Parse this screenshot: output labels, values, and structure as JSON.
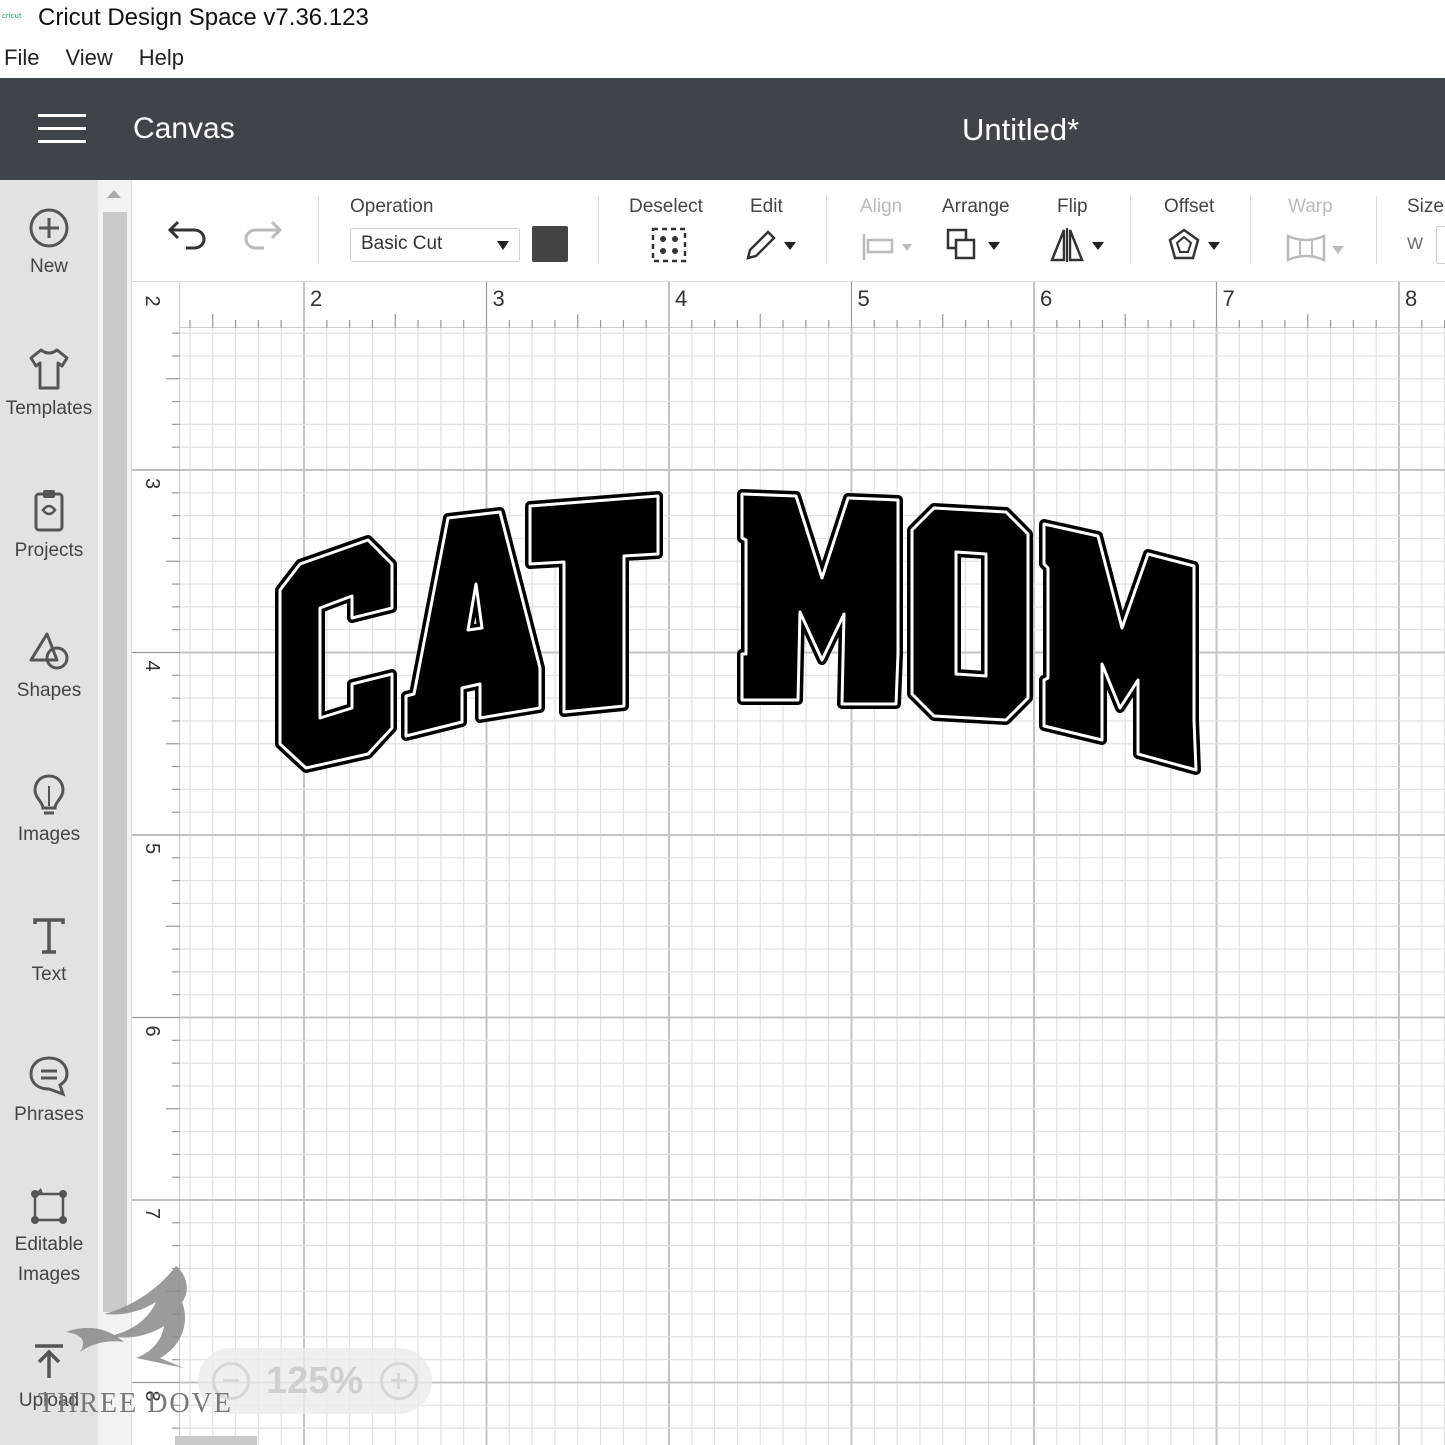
{
  "titlebar": {
    "logo_text": "cricut",
    "title": "Cricut Design Space  v7.36.123"
  },
  "menu": [
    "File",
    "View",
    "Help"
  ],
  "header": {
    "section": "Canvas",
    "document_title": "Untitled*"
  },
  "sidebar": {
    "items": [
      {
        "label": "New",
        "icon": "plus-circle-icon"
      },
      {
        "label": "Templates",
        "icon": "shirt-icon"
      },
      {
        "label": "Projects",
        "icon": "clipboard-icon"
      },
      {
        "label": "Shapes",
        "icon": "shapes-icon"
      },
      {
        "label": "Images",
        "icon": "lightbulb-icon"
      },
      {
        "label": "Text",
        "icon": "text-icon"
      },
      {
        "label": "Phrases",
        "icon": "speech-bubble-icon"
      },
      {
        "label": "Editable",
        "label2": "Images",
        "icon": "editable-images-icon"
      },
      {
        "label": "Upload",
        "icon": "upload-icon"
      }
    ]
  },
  "toolbar": {
    "operation_label": "Operation",
    "operation_value": "Basic Cut",
    "swatch_color": "#444444",
    "deselect": "Deselect",
    "edit": "Edit",
    "align": "Align",
    "arrange": "Arrange",
    "flip": "Flip",
    "offset": "Offset",
    "warp": "Warp",
    "size": "Size",
    "size_w": "W"
  },
  "ruler": {
    "top": [
      "2",
      "3",
      "4",
      "5",
      "6",
      "7",
      "8"
    ],
    "left": [
      "2",
      "3",
      "4",
      "5",
      "6",
      "7",
      "8"
    ]
  },
  "canvas": {
    "design_text": "CAT MOM"
  },
  "zoom": {
    "value": "125%"
  },
  "watermark": "THREE DOVE"
}
